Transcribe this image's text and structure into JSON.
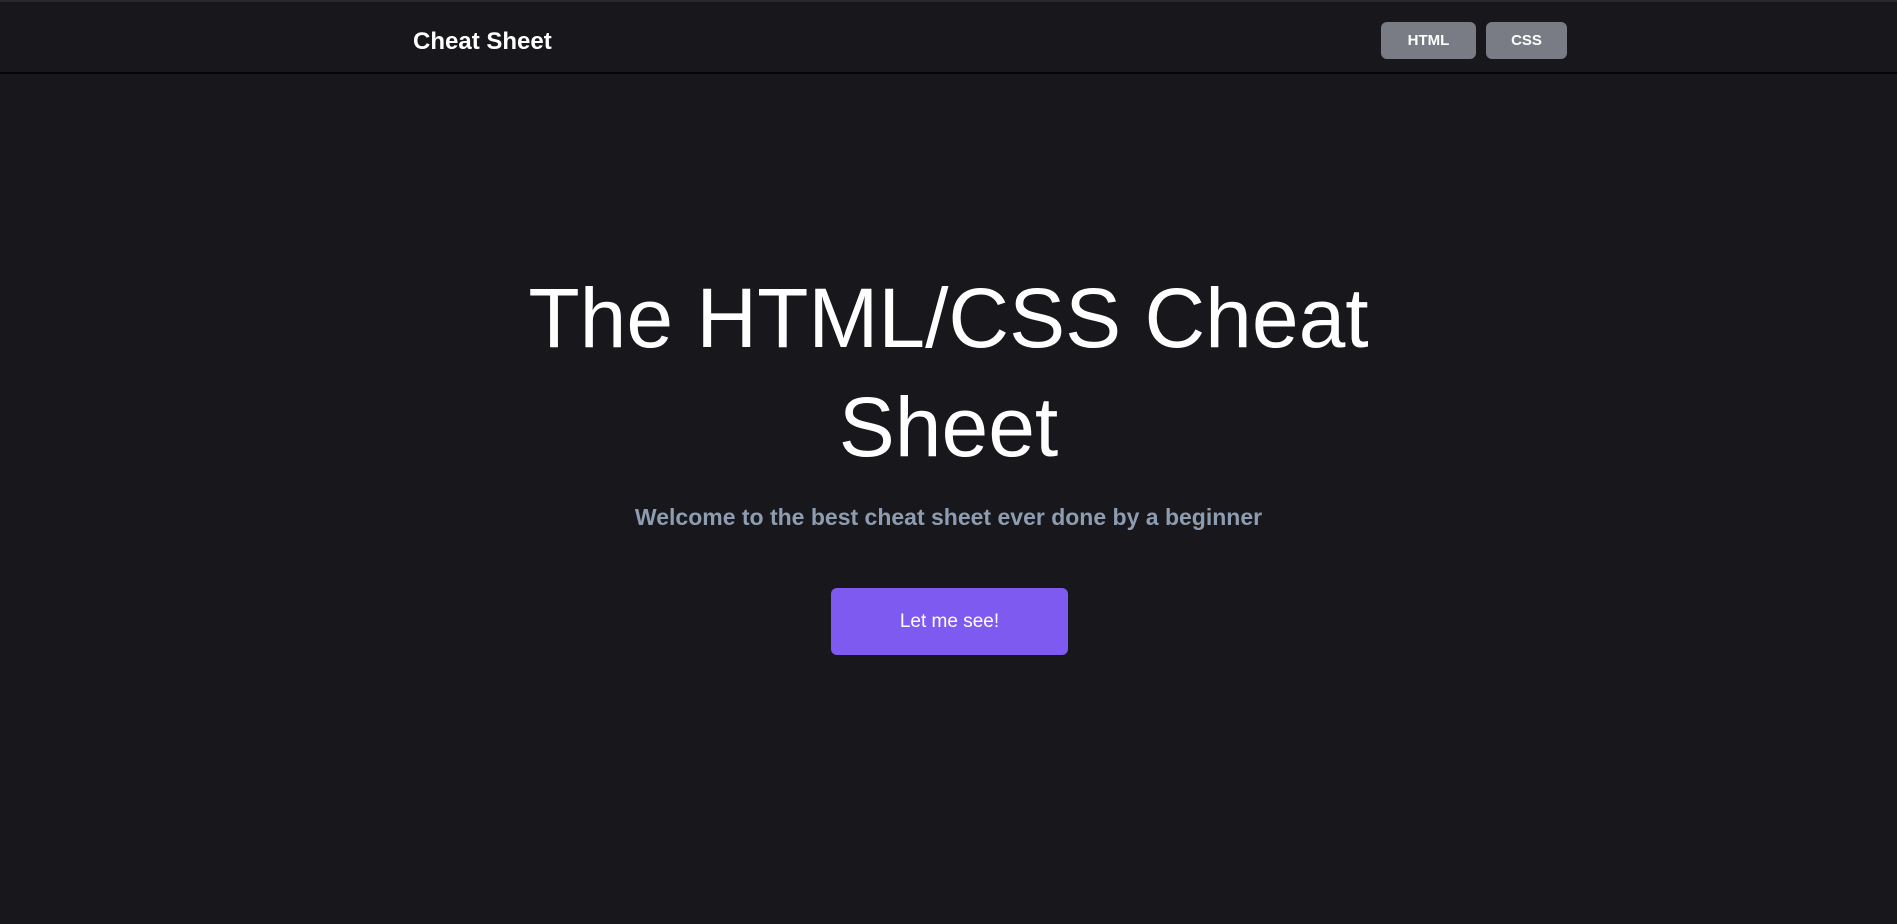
{
  "nav": {
    "brand": "Cheat Sheet",
    "buttons": [
      "HTML",
      "CSS"
    ]
  },
  "hero": {
    "title_line1": "The HTML/CSS Cheat",
    "title_line2": "Sheet",
    "subtitle": "Welcome to the best cheat sheet ever done by a beginner",
    "cta_label": "Let me see!"
  },
  "colors": {
    "background": "#18181c",
    "accent": "#7f5af0",
    "nav_button": "#7a7c85",
    "subtitle": "#8d9cb0"
  }
}
